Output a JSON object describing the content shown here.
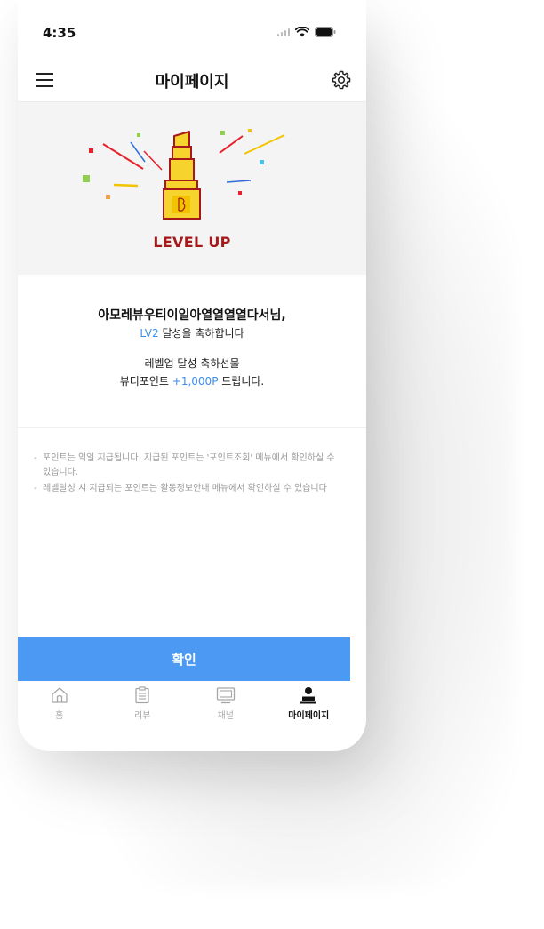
{
  "status_bar": {
    "time": "4:35"
  },
  "header": {
    "title": "마이페이지",
    "menu_icon": "hamburger-menu-icon",
    "settings_icon": "gear-icon"
  },
  "hero": {
    "badge_text": "LEVEL UP",
    "illustration": "lipstick-icon",
    "badge_color": "#a6191b"
  },
  "message": {
    "greeting": "아모레뷰우티이일아열열열열다서님,",
    "level": "LV2",
    "congrats_suffix": " 달성을 축하합니다",
    "gift_line1": "레벨업 달성 축하선물",
    "gift_prefix": "뷰티포인트 ",
    "points": "+1,000P",
    "gift_suffix": " 드립니다."
  },
  "notes": [
    "포인트는 익일 지급됩니다. 지급된 포인트는 '포인트조회' 메뉴에서 확인하실 수 있습니다.",
    "레벨달성 시 지급되는 포인트는 활동정보안내 메뉴에서 확인하실 수 있습니다"
  ],
  "note_dash": "-",
  "confirm_button": {
    "label": "확인",
    "color": "#4b99f2"
  },
  "tabs": [
    {
      "label": "홈",
      "icon": "home-icon"
    },
    {
      "label": "리뷰",
      "icon": "review-clipboard-icon"
    },
    {
      "label": "채널",
      "icon": "channel-tv-icon"
    },
    {
      "label": "마이페이지",
      "icon": "person-icon",
      "active": true
    }
  ],
  "accent_color": "#3b8ef0"
}
